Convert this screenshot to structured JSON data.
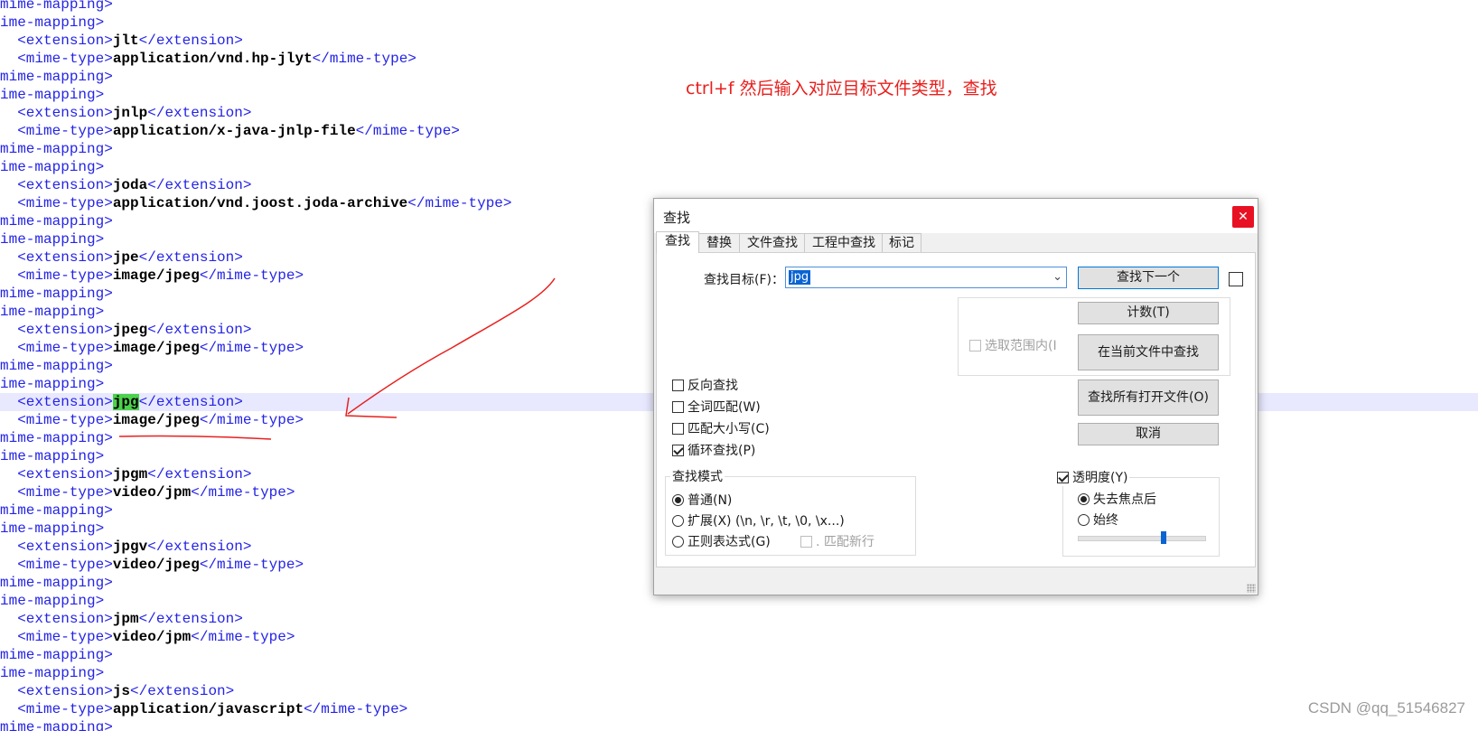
{
  "editor": {
    "lines": [
      {
        "indent": "",
        "tag_open": "mime-mapping>",
        "value": "",
        "tag_close": ""
      },
      {
        "indent": "",
        "tag_open": "ime-mapping>",
        "value": "",
        "tag_close": ""
      },
      {
        "indent": "  ",
        "tag_open": "<extension>",
        "value": "jlt",
        "tag_close": "</extension>"
      },
      {
        "indent": "  ",
        "tag_open": "<mime-type>",
        "value": "application/vnd.hp-jlyt",
        "tag_close": "</mime-type>"
      },
      {
        "indent": "",
        "tag_open": "mime-mapping>",
        "value": "",
        "tag_close": ""
      },
      {
        "indent": "",
        "tag_open": "ime-mapping>",
        "value": "",
        "tag_close": ""
      },
      {
        "indent": "  ",
        "tag_open": "<extension>",
        "value": "jnlp",
        "tag_close": "</extension>"
      },
      {
        "indent": "  ",
        "tag_open": "<mime-type>",
        "value": "application/x-java-jnlp-file",
        "tag_close": "</mime-type>"
      },
      {
        "indent": "",
        "tag_open": "mime-mapping>",
        "value": "",
        "tag_close": ""
      },
      {
        "indent": "",
        "tag_open": "ime-mapping>",
        "value": "",
        "tag_close": ""
      },
      {
        "indent": "  ",
        "tag_open": "<extension>",
        "value": "joda",
        "tag_close": "</extension>"
      },
      {
        "indent": "  ",
        "tag_open": "<mime-type>",
        "value": "application/vnd.joost.joda-archive",
        "tag_close": "</mime-type>"
      },
      {
        "indent": "",
        "tag_open": "mime-mapping>",
        "value": "",
        "tag_close": ""
      },
      {
        "indent": "",
        "tag_open": "ime-mapping>",
        "value": "",
        "tag_close": ""
      },
      {
        "indent": "  ",
        "tag_open": "<extension>",
        "value": "jpe",
        "tag_close": "</extension>"
      },
      {
        "indent": "  ",
        "tag_open": "<mime-type>",
        "value": "image/jpeg",
        "tag_close": "</mime-type>"
      },
      {
        "indent": "",
        "tag_open": "mime-mapping>",
        "value": "",
        "tag_close": ""
      },
      {
        "indent": "",
        "tag_open": "ime-mapping>",
        "value": "",
        "tag_close": ""
      },
      {
        "indent": "  ",
        "tag_open": "<extension>",
        "value": "jpeg",
        "tag_close": "</extension>"
      },
      {
        "indent": "  ",
        "tag_open": "<mime-type>",
        "value": "image/jpeg",
        "tag_close": "</mime-type>"
      },
      {
        "indent": "",
        "tag_open": "mime-mapping>",
        "value": "",
        "tag_close": ""
      },
      {
        "indent": "",
        "tag_open": "ime-mapping>",
        "value": "",
        "tag_close": ""
      },
      {
        "indent": "  ",
        "tag_open": "<extension>",
        "value": "jpg",
        "tag_close": "</extension>",
        "highlight": true,
        "current": true
      },
      {
        "indent": "  ",
        "tag_open": "<mime-type>",
        "value": "image/jpeg",
        "tag_close": "</mime-type>"
      },
      {
        "indent": "",
        "tag_open": "mime-mapping>",
        "value": "",
        "tag_close": ""
      },
      {
        "indent": "",
        "tag_open": "ime-mapping>",
        "value": "",
        "tag_close": ""
      },
      {
        "indent": "  ",
        "tag_open": "<extension>",
        "value": "jpgm",
        "tag_close": "</extension>"
      },
      {
        "indent": "  ",
        "tag_open": "<mime-type>",
        "value": "video/jpm",
        "tag_close": "</mime-type>"
      },
      {
        "indent": "",
        "tag_open": "mime-mapping>",
        "value": "",
        "tag_close": ""
      },
      {
        "indent": "",
        "tag_open": "ime-mapping>",
        "value": "",
        "tag_close": ""
      },
      {
        "indent": "  ",
        "tag_open": "<extension>",
        "value": "jpgv",
        "tag_close": "</extension>"
      },
      {
        "indent": "  ",
        "tag_open": "<mime-type>",
        "value": "video/jpeg",
        "tag_close": "</mime-type>"
      },
      {
        "indent": "",
        "tag_open": "mime-mapping>",
        "value": "",
        "tag_close": ""
      },
      {
        "indent": "",
        "tag_open": "ime-mapping>",
        "value": "",
        "tag_close": ""
      },
      {
        "indent": "  ",
        "tag_open": "<extension>",
        "value": "jpm",
        "tag_close": "</extension>"
      },
      {
        "indent": "  ",
        "tag_open": "<mime-type>",
        "value": "video/jpm",
        "tag_close": "</mime-type>"
      },
      {
        "indent": "",
        "tag_open": "mime-mapping>",
        "value": "",
        "tag_close": ""
      },
      {
        "indent": "",
        "tag_open": "ime-mapping>",
        "value": "",
        "tag_close": ""
      },
      {
        "indent": "  ",
        "tag_open": "<extension>",
        "value": "js",
        "tag_close": "</extension>"
      },
      {
        "indent": "  ",
        "tag_open": "<mime-type>",
        "value": "application/javascript",
        "tag_close": "</mime-type>"
      },
      {
        "indent": "",
        "tag_open": "mime-mapping>",
        "value": "",
        "tag_close": ""
      }
    ]
  },
  "annotation": {
    "text": "ctrl+f 然后输入对应目标文件类型，查找",
    "color": "#e8201e"
  },
  "dialog": {
    "title": "查找",
    "close_glyph": "✕",
    "tabs": [
      "查找",
      "替换",
      "文件查找",
      "工程中查找",
      "标记"
    ],
    "active_tab": 0,
    "find_what_label": "查找目标(F)：",
    "find_what_value": "jpg",
    "combo_arrow": "⌄",
    "buttons": {
      "find_next": "查找下一个",
      "count": "计数(T)",
      "find_in_current": "在当前文件中查找",
      "find_all_open": "查找所有打开文件(O)",
      "cancel": "取消"
    },
    "in_selection": "选取范围内(I",
    "options": {
      "backward": "反向查找",
      "whole_word": "全词匹配(W)",
      "match_case": "匹配大小写(C)",
      "wrap_around": "循环查找(P)"
    },
    "search_mode": {
      "legend": "查找模式",
      "normal": "普通(N)",
      "extended": "扩展(X) (\\n, \\r, \\t, \\0, \\x...)",
      "regex": "正则表达式(G)",
      "dot_newline": ". 匹配新行"
    },
    "transparency": {
      "label": "透明度(Y)",
      "on_lose_focus": "失去焦点后",
      "always": "始终",
      "level": 0.68
    }
  },
  "watermark": "CSDN @qq_51546827"
}
